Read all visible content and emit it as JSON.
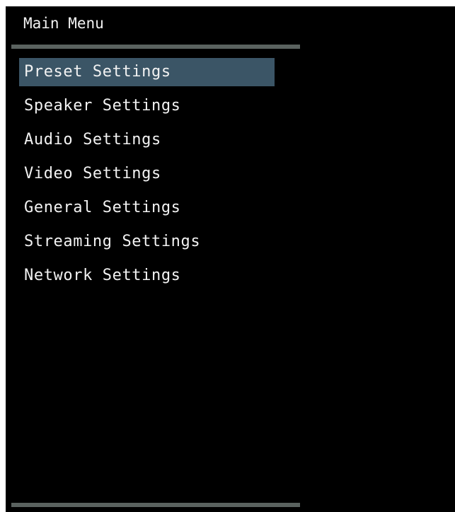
{
  "menu": {
    "title": "Main Menu",
    "selected_index": 0,
    "items": [
      {
        "label": "Preset Settings"
      },
      {
        "label": "Speaker Settings"
      },
      {
        "label": "Audio Settings"
      },
      {
        "label": "Video Settings"
      },
      {
        "label": "General Settings"
      },
      {
        "label": "Streaming Settings"
      },
      {
        "label": "Network Settings"
      }
    ]
  },
  "colors": {
    "background": "#000000",
    "text": "#f2f2f2",
    "selection": "#3b5566",
    "divider": "#5a625f"
  }
}
